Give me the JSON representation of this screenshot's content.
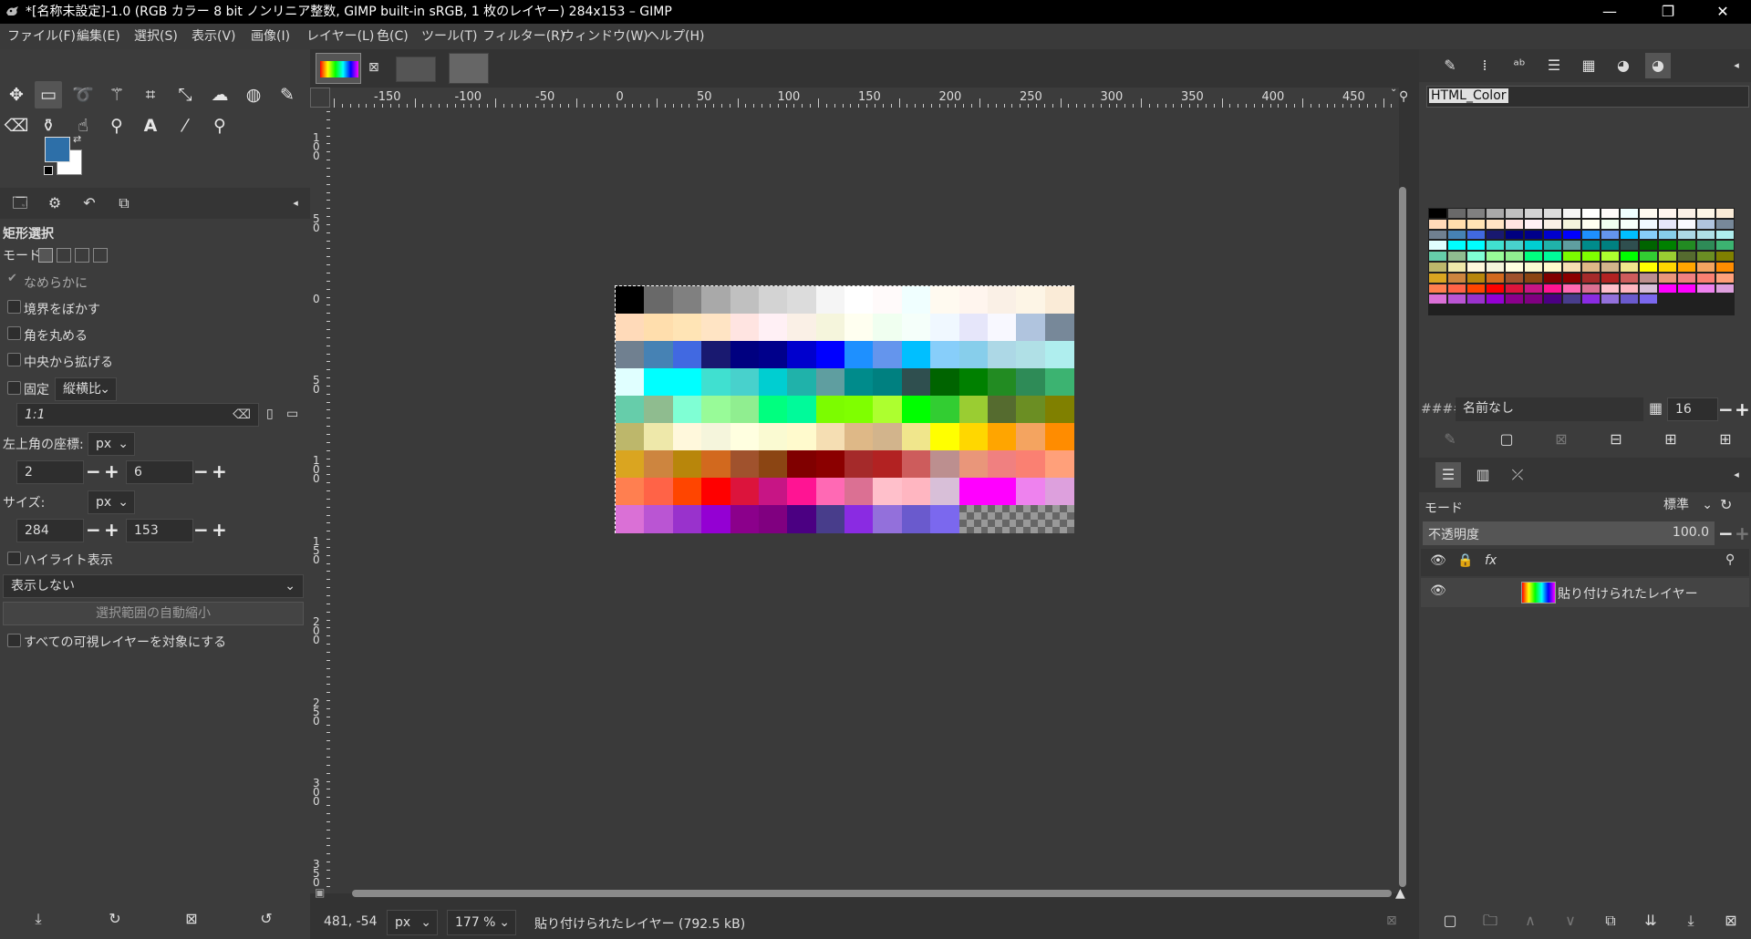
{
  "window": {
    "title": "*[名称未設定]-1.0 (RGB カラー 8 bit ノンリニア整数, GIMP built-in sRGB, 1 枚のレイヤー) 284x153 – GIMP",
    "minimize": "—",
    "restore": "❐",
    "close": "✕"
  },
  "menu": [
    "ファイル(F)",
    "編集(E)",
    "選択(S)",
    "表示(V)",
    "画像(I)",
    "レイヤー(L)",
    "色(C)",
    "ツール(T)",
    "フィルター(R)",
    "ウィンドウ(W)",
    "ヘルプ(H)"
  ],
  "tool_options": {
    "title": "矩形選択",
    "mode_label": "モード:",
    "antialias": "なめらかに",
    "feather": "境界をぼかす",
    "rounded": "角を丸める",
    "expand_center": "中央から拡げる",
    "fixed": "固定",
    "fixed_mode": "縦横比",
    "ratio_value": "1:1",
    "position_label": "左上角の座標:",
    "position_unit": "px",
    "pos_x": "2",
    "pos_y": "6",
    "size_label": "サイズ:",
    "size_unit": "px",
    "size_w": "284",
    "size_h": "153",
    "highlight": "ハイライト表示",
    "guides": "表示しない",
    "auto_shrink": "選択範囲の自動縮小",
    "shrink_merged": "すべての可視レイヤーを対象にする"
  },
  "ruler": {
    "h_labels": [
      "-150",
      "-100",
      "-50",
      "0",
      "50",
      "100",
      "150",
      "200",
      "250",
      "300",
      "350",
      "400",
      "450"
    ],
    "v_labels": [
      "1\n0\n0",
      "5\n0",
      "0",
      "5\n0",
      "1\n0\n0",
      "1\n5\n0",
      "2\n0\n0",
      "2\n5\n0",
      "3\n0\n0",
      "3\n5\n0"
    ]
  },
  "status": {
    "coords": "481, -54",
    "unit": "px",
    "zoom": "177 %",
    "message": "貼り付けられたレイヤー (792.5 kB)"
  },
  "palette": {
    "name_field": "HTML_Color",
    "palette_name": "名前なし",
    "columns": "16",
    "hash": "####"
  },
  "layers": {
    "mode_label": "モード",
    "mode_value": "標準",
    "opacity_label": "不透明度",
    "opacity_value": "100.0",
    "layer_name": "貼り付けられたレイヤー"
  },
  "colors": {
    "fg": "#2d6fa8",
    "bg": "#ffffff",
    "image_rows": [
      [
        "#000000",
        "#696969",
        "#808080",
        "#a9a9a9",
        "#c0c0c0",
        "#d3d3d3",
        "#dcdcdc",
        "#f5f5f5",
        "#ffffff",
        "#fffafa",
        "#f0ffff",
        "#fffaf0",
        "#fff5ee",
        "#faf0e6",
        "#fdf5e6",
        "#faebd7"
      ],
      [
        "#ffdab9",
        "#ffdead",
        "#ffe4b5",
        "#ffe4c4",
        "#ffe4e1",
        "#fff0f5",
        "#faf0e6",
        "#f5f5dc",
        "#fffff0",
        "#f0fff0",
        "#f5fffa",
        "#f0f8ff",
        "#e6e6fa",
        "#f8f8ff",
        "#b0c4de",
        "#778899"
      ],
      [
        "#708090",
        "#4682b4",
        "#4169e1",
        "#191970",
        "#000080",
        "#00008b",
        "#0000cd",
        "#0000ff",
        "#1e90ff",
        "#6495ed",
        "#00bfff",
        "#87cefa",
        "#87ceeb",
        "#add8e6",
        "#b0e0e6",
        "#afeeee"
      ],
      [
        "#e0ffff",
        "#00ffff",
        "#00ffff",
        "#40e0d0",
        "#48d1cc",
        "#00ced1",
        "#20b2aa",
        "#5f9ea0",
        "#008b8b",
        "#008080",
        "#2f4f4f",
        "#006400",
        "#008000",
        "#228b22",
        "#2e8b57",
        "#3cb371"
      ],
      [
        "#66cdaa",
        "#8fbc8f",
        "#7fffd4",
        "#98fb98",
        "#90ee90",
        "#00ff7f",
        "#00fa9a",
        "#7cfc00",
        "#7fff00",
        "#adff2f",
        "#00ff00",
        "#32cd32",
        "#9acd32",
        "#556b2f",
        "#6b8e23",
        "#808000"
      ],
      [
        "#bdb76b",
        "#eee8aa",
        "#fff8dc",
        "#f5f5dc",
        "#ffffe0",
        "#fafad2",
        "#fffacd",
        "#f5deb3",
        "#deb887",
        "#d2b48c",
        "#f0e68c",
        "#ffff00",
        "#ffd700",
        "#ffa500",
        "#f4a460",
        "#ff8c00"
      ],
      [
        "#daa520",
        "#cd853f",
        "#b8860b",
        "#d2691e",
        "#a0522d",
        "#8b4513",
        "#800000",
        "#8b0000",
        "#a52a2a",
        "#b22222",
        "#cd5c5c",
        "#bc8f8f",
        "#e9967a",
        "#f08080",
        "#fa8072",
        "#ffa07a"
      ],
      [
        "#ff7f50",
        "#ff6347",
        "#ff4500",
        "#ff0000",
        "#dc143c",
        "#c71585",
        "#ff1493",
        "#ff69b4",
        "#db7093",
        "#ffc0cb",
        "#ffb6c1",
        "#d8bfd8",
        "#ff00ff",
        "#ff00ff",
        "#ee82ee",
        "#dda0dd"
      ],
      [
        "#da70d6",
        "#ba55d3",
        "#9932cc",
        "#9400d3",
        "#8b008b",
        "#800080",
        "#4b0082",
        "#483d8b",
        "#8a2be2",
        "#9370db",
        "#6a5acd",
        "#7b68ee",
        "#checker",
        "#checker",
        "#checker",
        "#checker"
      ]
    ]
  }
}
